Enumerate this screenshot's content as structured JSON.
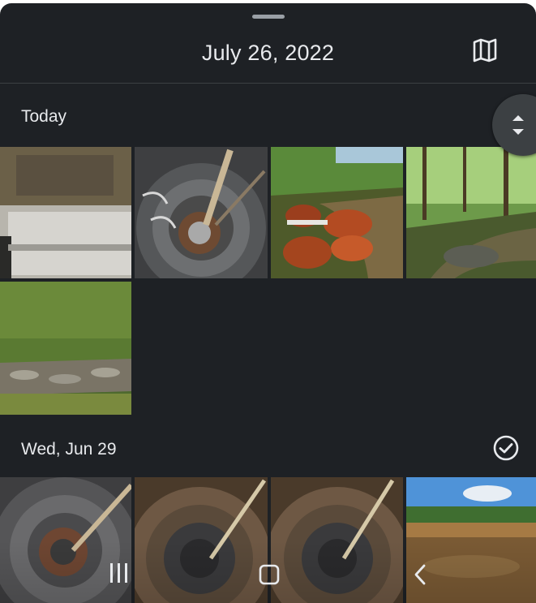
{
  "header": {
    "title": "July 26, 2022",
    "map_icon": "map-icon"
  },
  "sections": [
    {
      "label": "Today",
      "photos": [
        {
          "subject": "Stainless steel appliance interior"
        },
        {
          "subject": "Pipe with drain tube"
        },
        {
          "subject": "Rocky stream with red stones"
        },
        {
          "subject": "Forest stream with boulders"
        },
        {
          "subject": "Creek bed in forest"
        }
      ]
    },
    {
      "label": "Wed, Jun 29",
      "select_icon": "check-circle-icon",
      "photos": [
        {
          "subject": "Pipe with drain tube"
        },
        {
          "subject": "Pipe interior close-up"
        },
        {
          "subject": "Pipe interior close-up"
        },
        {
          "subject": "Muddy stream under blue sky"
        }
      ]
    }
  ],
  "navigation": {
    "recents_icon": "recents-icon",
    "home_icon": "home-icon",
    "back_icon": "back-icon"
  },
  "colors": {
    "background": "#1e2125",
    "text": "#e8eaed",
    "divider": "#3c4043"
  }
}
